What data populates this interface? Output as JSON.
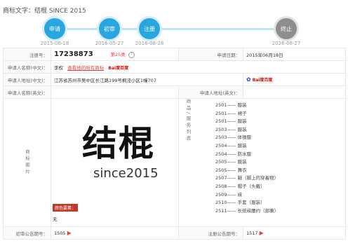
{
  "header": {
    "title": "商标文字：结棍 SINCE 2015"
  },
  "timeline": {
    "steps": [
      {
        "label": "申请",
        "date": "2015-06-18"
      },
      {
        "label": "初审",
        "date": "2016-05-27"
      },
      {
        "label": "注册",
        "date": "2016-08-28"
      },
      {
        "label": "终止",
        "date": "2026-08-27"
      }
    ]
  },
  "info": {
    "reg_no_label": "注册号：",
    "reg_no": "17238873",
    "class_text": "第25类",
    "apply_date_label": "申请日期：",
    "apply_date": "2015年06月18日",
    "applicant_cn_label": "申请人名称(中文)：",
    "applicant_cn": "李权",
    "applicant_link": "查看他的所有商标",
    "baidu": "Bai度百度",
    "address_cn_label": "申请人地址(中文)：",
    "address_cn": "江苏省苏州市吴中区长江路199号桐泾小区1幢707",
    "applicant_en_label": "申请人名称(英文)：",
    "address_en_label": "申请人地址(英文)："
  },
  "mark": {
    "image_label": "商标图片",
    "text_cn": "结棍",
    "text_en": "since2015",
    "color_label": "颜色要素：",
    "color_value": "无"
  },
  "goods": {
    "label": "商品/服务列表",
    "items": [
      "2501—— 服装",
      "2501—— 裙子",
      "2501—— 服装",
      "2503—— 服装",
      "2503—— 体操服",
      "2504—— 服装",
      "2504—— 防水服",
      "2505—— 服装",
      "2505—— 舞衣",
      "2507—— 鞋（脚上的穿着物）",
      "2508—— 帽子（头戴）",
      "2509—— 袜",
      "2510—— 手套（服装）",
      "2511—— 长统袜腰约（部裹）"
    ]
  },
  "pub": {
    "prelim_label": "初审公告期号：",
    "prelim_no": "1505",
    "reg_pub_label": "注册公告期号：",
    "reg_pub_no": "1517"
  }
}
